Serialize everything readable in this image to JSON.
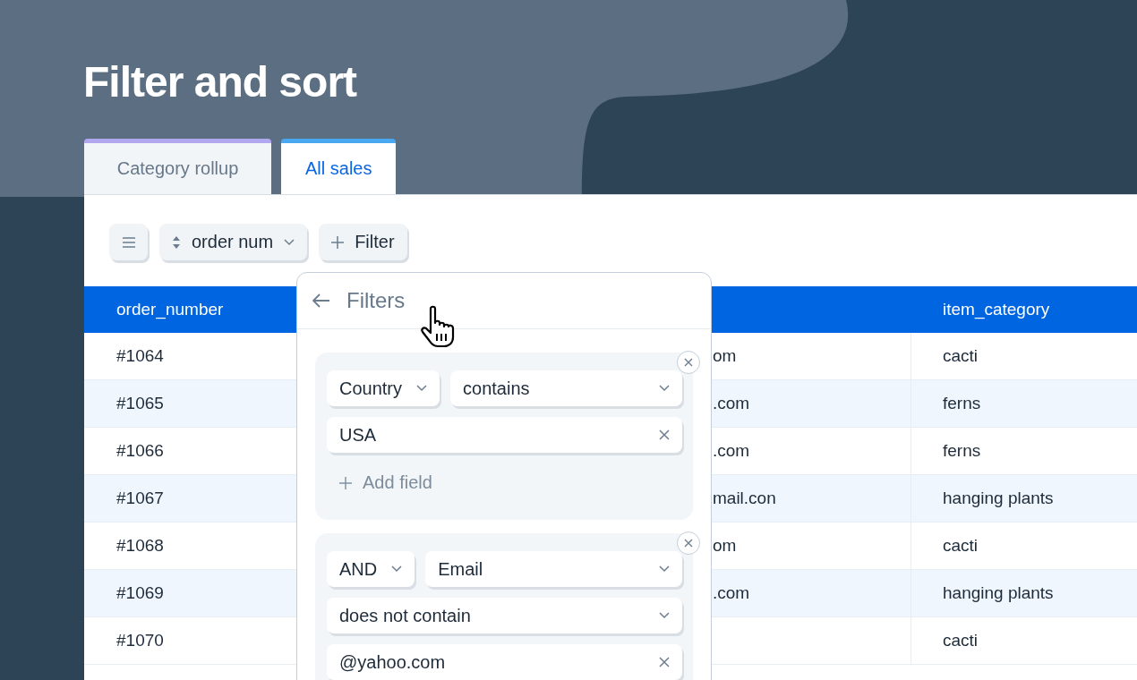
{
  "title": "Filter and sort",
  "tabs": [
    {
      "label": "Category rollup",
      "selected": false
    },
    {
      "label": "All sales",
      "selected": true
    }
  ],
  "toolbar": {
    "sort_label": "order num",
    "filter_label": "Filter"
  },
  "table": {
    "columns": [
      "order_number",
      "item_category"
    ],
    "rows": [
      {
        "order_number": "#1064",
        "column_2": "om",
        "item_category": "cacti"
      },
      {
        "order_number": "#1065",
        "column_2": ".com",
        "item_category": "ferns"
      },
      {
        "order_number": "#1066",
        "column_2": ".com",
        "item_category": "ferns"
      },
      {
        "order_number": "#1067",
        "column_2": "mail.con",
        "item_category": "hanging plants"
      },
      {
        "order_number": "#1068",
        "column_2": "om",
        "item_category": "cacti"
      },
      {
        "order_number": "#1069",
        "column_2": ".com",
        "item_category": "hanging plants"
      },
      {
        "order_number": "#1070",
        "item_category": "cacti"
      }
    ]
  },
  "filters_popup": {
    "title": "Filters",
    "groups": [
      {
        "rows": [
          [
            {
              "kind": "select",
              "value": "Country"
            },
            {
              "kind": "select",
              "value": "contains"
            }
          ],
          [
            {
              "kind": "text",
              "value": "USA"
            }
          ]
        ],
        "add_field": "Add field"
      },
      {
        "rows": [
          [
            {
              "kind": "select",
              "value": "AND"
            },
            {
              "kind": "select",
              "value": "Email"
            }
          ],
          [
            {
              "kind": "select",
              "value": "does not contain"
            }
          ],
          [
            {
              "kind": "text",
              "value": "@yahoo.com"
            }
          ]
        ]
      }
    ]
  }
}
